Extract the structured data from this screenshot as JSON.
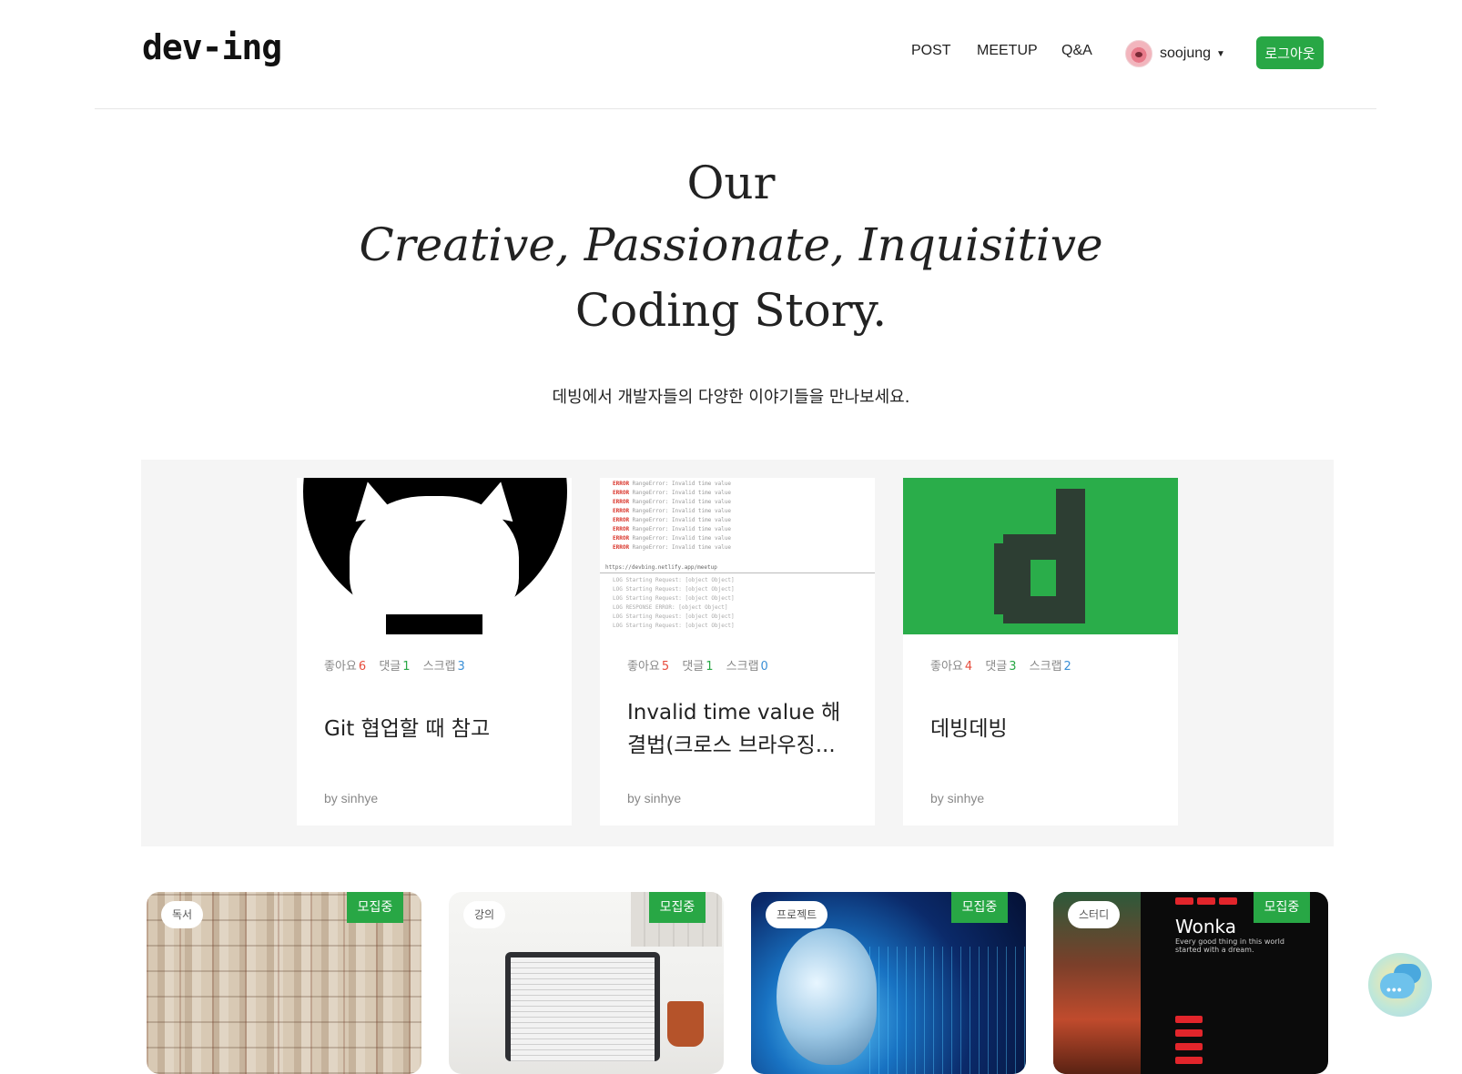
{
  "brand": {
    "logo": "dev-ing"
  },
  "nav": {
    "items": [
      {
        "label": "POST"
      },
      {
        "label": "MEETUP"
      },
      {
        "label": "Q&A"
      }
    ],
    "user": {
      "name": "soojung"
    },
    "logout_label": "로그아웃"
  },
  "hero": {
    "line1": "Our",
    "line2": "Creative, Passionate, Inquisitive",
    "line3": "Coding Story.",
    "subtitle": "데빙에서 개발자들의 다양한 이야기들을 만나보세요."
  },
  "stat_labels": {
    "like": "좋아요",
    "comment": "댓글",
    "scrap": "스크랩"
  },
  "posts": [
    {
      "thumb": "github-octocat",
      "likes": "6",
      "comments": "1",
      "scraps": "3",
      "title": "Git 협업할 때 참고",
      "author": "by sinhye"
    },
    {
      "thumb": "console-log",
      "likes": "5",
      "comments": "1",
      "scraps": "0",
      "title": "Invalid time value 해결법(크로스 브라우징...",
      "author": "by sinhye"
    },
    {
      "thumb": "devbing-d-logo",
      "likes": "4",
      "comments": "3",
      "scraps": "2",
      "title": "데빙데빙",
      "author": "by sinhye"
    }
  ],
  "log_thumb": {
    "error_tag": "ERROR",
    "error_text": "RangeError: Invalid time value",
    "url": "https://devbing.netlify.app/meetup",
    "ok_lines": [
      "LOG Starting Request: [object Object]",
      "LOG Starting Request: [object Object]",
      "LOG Starting Request: [object Object]",
      "LOG RESPONSE ERROR: [object Object]",
      "LOG Starting Request: [object Object]",
      "LOG Starting Request: [object Object]"
    ]
  },
  "meetups": [
    {
      "category": "독서",
      "status": "모집중",
      "image": "books"
    },
    {
      "category": "강의",
      "status": "모집중",
      "image": "laptop-desk"
    },
    {
      "category": "프로젝트",
      "status": "모집중",
      "image": "ai-head"
    },
    {
      "category": "스터디",
      "status": "모집중",
      "image": "wonka"
    }
  ],
  "wonka": {
    "title": "Wonka",
    "tagline": "Every good thing in this world started with a dream."
  },
  "colors": {
    "accent": "#28a745",
    "like": "#e74c3c",
    "comment": "#28a745",
    "scrap": "#3a8fd6",
    "section_bg": "#f5f5f5"
  },
  "icons": {
    "chat_fab": "chat-bubble-icon",
    "user_caret": "caret-down-icon"
  }
}
